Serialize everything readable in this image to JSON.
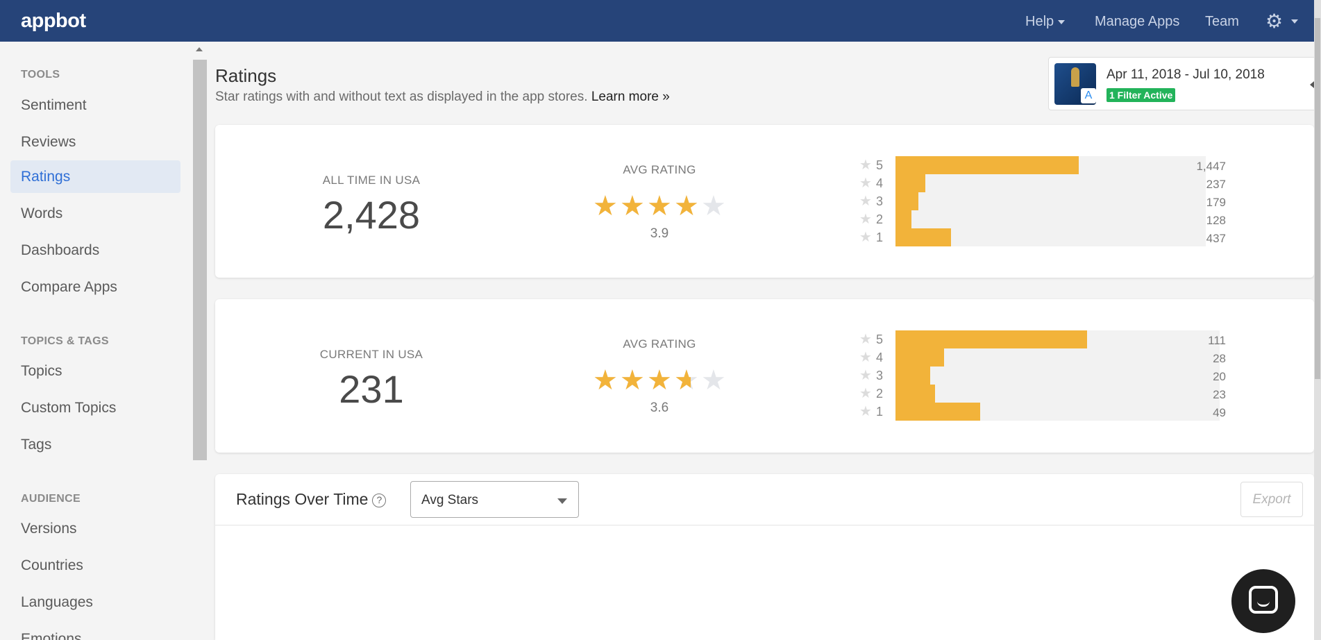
{
  "topnav": {
    "logo": "appbot",
    "help": "Help",
    "manage_apps": "Manage Apps",
    "team": "Team",
    "settings_icon": "gear-icon"
  },
  "sidebar": {
    "sections": [
      {
        "heading": "TOOLS",
        "items": [
          "Sentiment",
          "Reviews",
          "Ratings",
          "Words",
          "Dashboards",
          "Compare Apps"
        ]
      },
      {
        "heading": "TOPICS & TAGS",
        "items": [
          "Topics",
          "Custom Topics",
          "Tags"
        ]
      },
      {
        "heading": "AUDIENCE",
        "items": [
          "Versions",
          "Countries",
          "Languages",
          "Emotions"
        ]
      }
    ],
    "active_item": "Ratings"
  },
  "header": {
    "title": "Ratings",
    "subtitle": "Star ratings with and without text as displayed in the app stores.",
    "learn_more": "Learn more »"
  },
  "filter": {
    "date_range": "Apr 11, 2018 - Jul 10, 2018",
    "badge": "1 Filter Active"
  },
  "all_time": {
    "label": "ALL TIME IN USA",
    "total": "2,428",
    "avg_label": "AVG RATING",
    "avg": "3.9",
    "avg_value": 3.9,
    "distribution": [
      {
        "stars": "5",
        "count": "1,447",
        "value": 1447
      },
      {
        "stars": "4",
        "count": "237",
        "value": 237
      },
      {
        "stars": "3",
        "count": "179",
        "value": 179
      },
      {
        "stars": "2",
        "count": "128",
        "value": 128
      },
      {
        "stars": "1",
        "count": "437",
        "value": 437
      }
    ]
  },
  "current": {
    "label": "CURRENT IN USA",
    "total": "231",
    "avg_label": "AVG RATING",
    "avg": "3.6",
    "avg_value": 3.6,
    "distribution": [
      {
        "stars": "5",
        "count": "111",
        "value": 111
      },
      {
        "stars": "4",
        "count": "28",
        "value": 28
      },
      {
        "stars": "3",
        "count": "20",
        "value": 20
      },
      {
        "stars": "2",
        "count": "23",
        "value": 23
      },
      {
        "stars": "1",
        "count": "49",
        "value": 49
      }
    ]
  },
  "over_time": {
    "title": "Ratings Over Time",
    "help_icon": "question-circle-icon",
    "select_value": "Avg Stars",
    "export_label": "Export"
  },
  "colors": {
    "nav_bg": "#264479",
    "star": "#f2b33a",
    "active_link": "#2f6fd6",
    "badge_green": "#22b35a"
  }
}
